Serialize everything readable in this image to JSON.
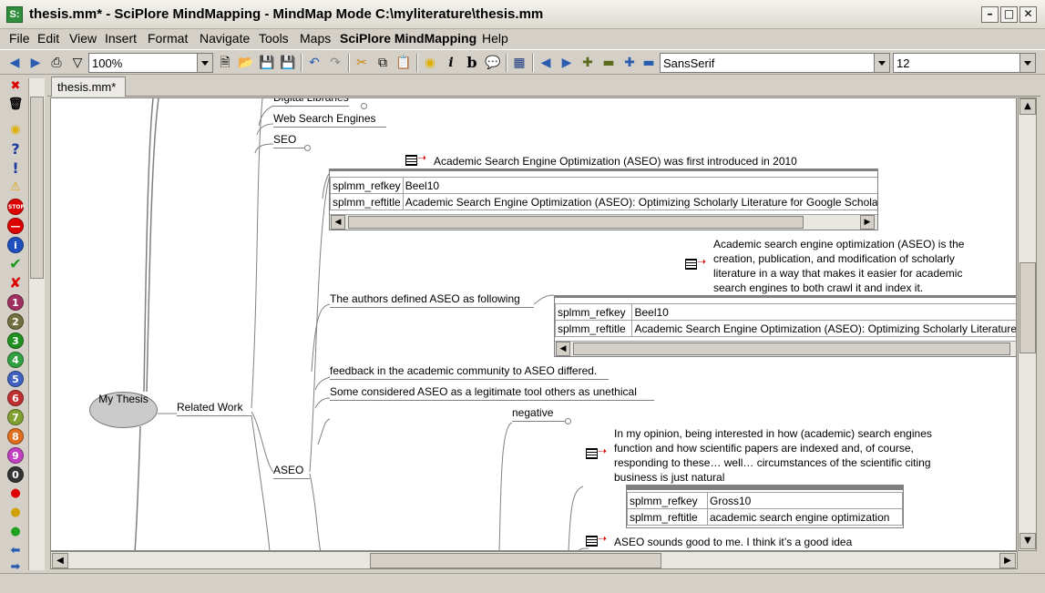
{
  "window": {
    "title": "thesis.mm* - SciPlore MindMapping - MindMap Mode C:\\myliterature\\thesis.mm",
    "app_icon": "S:"
  },
  "menu": {
    "items": [
      "File",
      "Edit",
      "View",
      "Insert",
      "Format",
      "Navigate",
      "Tools",
      "Maps",
      "SciPlore MindMapping",
      "Help"
    ]
  },
  "toolbar": {
    "zoom": "100%",
    "font": "SansSerif",
    "font_size": "12"
  },
  "tab": {
    "label": "thesis.mm*"
  },
  "mindmap": {
    "root": "My Thesis",
    "related_work": "Related Work",
    "digital_libraries": "Digital Libraries",
    "web_search_engines": "Web Search Engines",
    "seo": "SEO",
    "aseo": "ASEO",
    "note1": "Academic Search Engine Optimization (ASEO) was first introduced in 2010",
    "table1": {
      "row1_key": "splmm_refkey",
      "row1_val": "Beel10",
      "row2_key": "splmm_reftitle",
      "row2_val": "Academic Search Engine Optimization (ASEO): Optimizing Scholarly Literature for Google Scholar"
    },
    "authors_defined": "The authors defined ASEO as following",
    "definition_lines": [
      "Academic search engine optimization (ASEO) is the",
      "creation, publication, and modification of scholarly",
      "literature in a way that makes it easier for academic",
      "search engines to both crawl it and index it."
    ],
    "table2": {
      "row1_key": "splmm_refkey",
      "row1_val": "Beel10",
      "row2_key": "splmm_reftitle",
      "row2_val": "Academic Search Engine Optimization (ASEO): Optimizing Scholarly Literature"
    },
    "feedback": "feedback in the academic community to ASEO differed.",
    "some_considered": "Some considered ASEO as a legitimate tool others as unethical",
    "negative": "negative",
    "opinion_lines": [
      "In my opinion, being interested in how (academic) search engines",
      "function and how scientific papers are indexed and, of course,",
      "responding to  these… well… circumstances of the scientific citing",
      "business is just natural"
    ],
    "table3": {
      "row1_key": "splmm_refkey",
      "row1_val": "Gross10",
      "row2_key": "splmm_reftitle",
      "row2_val": "academic search engine optimization"
    },
    "sounds_good": "ASEO sounds good to me. I think it’s a good idea"
  }
}
